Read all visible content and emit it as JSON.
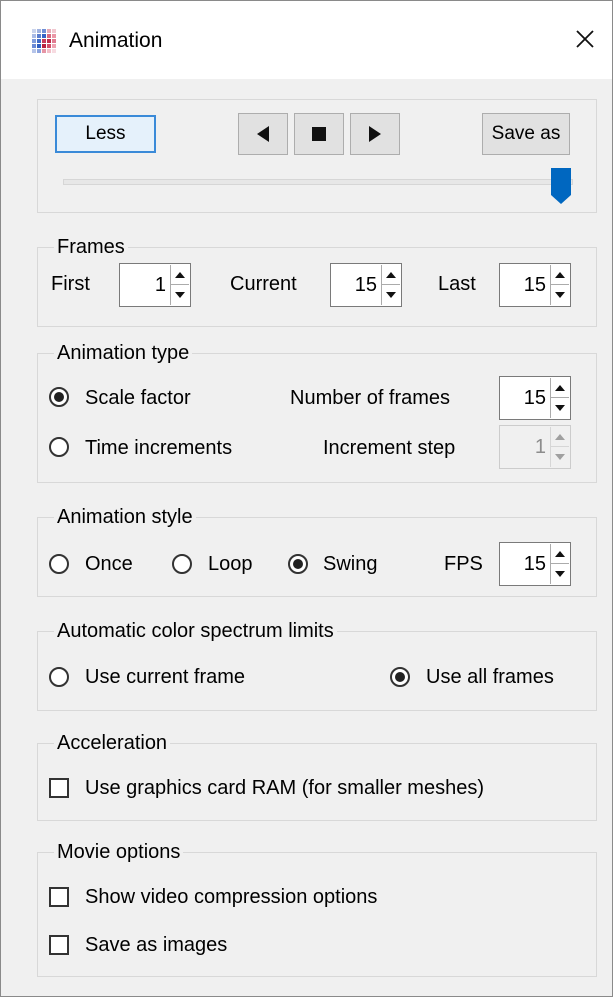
{
  "window": {
    "title": "Animation",
    "icon": "animation-grid-icon",
    "close_icon": "close-icon"
  },
  "controls": {
    "less_label": "Less",
    "prev_icon": "triangle-left-icon",
    "stop_icon": "square-stop-icon",
    "next_icon": "triangle-right-icon",
    "save_as_label": "Save as",
    "slider_value": 15,
    "slider_min": 1,
    "slider_max": 15
  },
  "frames": {
    "legend": "Frames",
    "first_label": "First",
    "first_value": "1",
    "current_label": "Current",
    "current_value": "15",
    "last_label": "Last",
    "last_value": "15"
  },
  "animation_type": {
    "legend": "Animation type",
    "scale_factor_label": "Scale factor",
    "time_increments_label": "Time increments",
    "selected": "Scale factor",
    "num_frames_label": "Number of frames",
    "num_frames_value": "15",
    "increment_step_label": "Increment step",
    "increment_step_value": "1"
  },
  "animation_style": {
    "legend": "Animation style",
    "once_label": "Once",
    "loop_label": "Loop",
    "swing_label": "Swing",
    "selected": "Swing",
    "fps_label": "FPS",
    "fps_value": "15"
  },
  "color_limits": {
    "legend": "Automatic color spectrum limits",
    "current_frame_label": "Use current frame",
    "all_frames_label": "Use all frames",
    "selected": "Use all frames"
  },
  "acceleration": {
    "legend": "Acceleration",
    "gpu_ram_label": "Use graphics card RAM (for smaller meshes)",
    "gpu_ram_checked": false
  },
  "movie_options": {
    "legend": "Movie options",
    "compression_label": "Show video compression options",
    "compression_checked": false,
    "save_images_label": "Save as images",
    "save_images_checked": false
  },
  "colors": {
    "accent": "#3a8ad8",
    "slider_thumb": "#0067c0",
    "dialog_bg": "#f0f0f0"
  }
}
